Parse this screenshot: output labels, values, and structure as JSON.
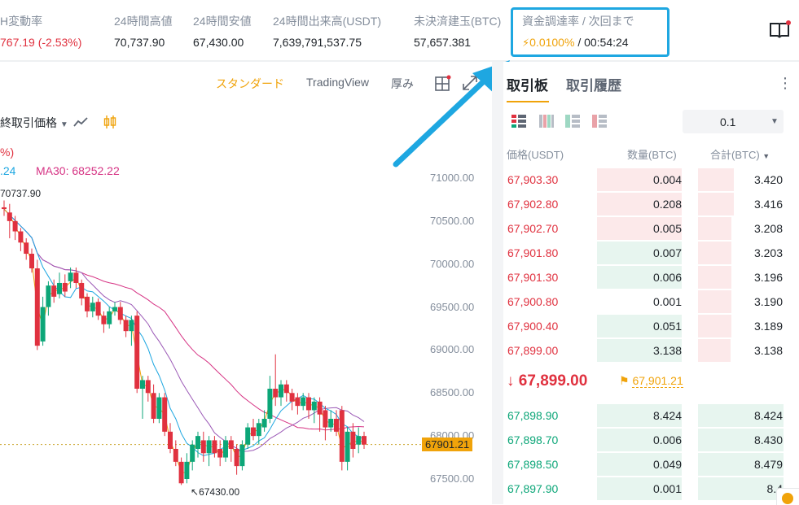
{
  "stats": [
    {
      "label": "H変動率",
      "value": "767.19 (-2.53%)",
      "color": "#e0313f"
    },
    {
      "label": "24時間高値",
      "value": "70,737.90"
    },
    {
      "label": "24時間安値",
      "value": "67,430.00"
    },
    {
      "label": "24時間出来高(USDT)",
      "value": "7,639,791,537.75"
    },
    {
      "label": "未決済建玉(BTC)",
      "value": "57,657.381"
    },
    {
      "label": "資金調達率 / 次回まで",
      "rate": "0.0100%",
      "countdown": "/ 00:54:24"
    }
  ],
  "chart_toolbar": {
    "standard": "スタンダード",
    "tradingview": "TradingView",
    "depth": "厚み"
  },
  "chart_header": {
    "price_type": "終取引価格",
    "pct_text": "%)",
    "ma_left": ".24",
    "ma30": "MA30: 68252.22",
    "high_label": "70737.90",
    "low_label": "67430.00",
    "current_price_tag": "67901.21"
  },
  "y_ticks": [
    "71000.00",
    "70500.00",
    "70000.00",
    "69500.00",
    "69000.00",
    "68500.00",
    "68000.00",
    "67500.00"
  ],
  "candles": [
    [
      70660,
      70640,
      70740,
      70560
    ],
    [
      70600,
      70500,
      70700,
      70300
    ],
    [
      70500,
      70380,
      70560,
      70280
    ],
    [
      70380,
      70250,
      70420,
      70150
    ],
    [
      70250,
      70120,
      70300,
      70050
    ],
    [
      70120,
      69950,
      70180,
      69900
    ],
    [
      69950,
      69050,
      70050,
      69000
    ],
    [
      69100,
      69500,
      69620,
      69050
    ],
    [
      69500,
      69750,
      69800,
      69400
    ],
    [
      69750,
      69620,
      69820,
      69550
    ],
    [
      69650,
      69780,
      69900,
      69600
    ],
    [
      69780,
      69680,
      69880,
      69620
    ],
    [
      69800,
      69900,
      69960,
      69720
    ],
    [
      69900,
      69780,
      69960,
      69720
    ],
    [
      69780,
      69600,
      69820,
      69520
    ],
    [
      69620,
      69450,
      69660,
      69380
    ],
    [
      69450,
      69550,
      69620,
      69380
    ],
    [
      69560,
      69400,
      69600,
      69350
    ],
    [
      69400,
      69300,
      69450,
      69200
    ],
    [
      69300,
      69450,
      69500,
      69250
    ],
    [
      69450,
      69500,
      69560,
      69400
    ],
    [
      69500,
      69350,
      69560,
      69300
    ],
    [
      69350,
      69220,
      69400,
      69150
    ],
    [
      69220,
      69350,
      69400,
      69050
    ],
    [
      69400,
      68550,
      69450,
      68500
    ],
    [
      68550,
      68650,
      68700,
      68200
    ],
    [
      68650,
      68500,
      68700,
      68400
    ],
    [
      68500,
      68200,
      68600,
      68150
    ],
    [
      68200,
      68450,
      68500,
      68150
    ],
    [
      68450,
      68050,
      68500,
      68000
    ],
    [
      68050,
      67850,
      68150,
      67800
    ],
    [
      67850,
      67700,
      67950,
      67650
    ],
    [
      67700,
      67450,
      67750,
      67430
    ],
    [
      67500,
      67700,
      67800,
      67450
    ],
    [
      67700,
      67900,
      67950,
      67600
    ],
    [
      67850,
      68000,
      68050,
      67750
    ],
    [
      67950,
      67800,
      68050,
      67700
    ],
    [
      67800,
      67950,
      68000,
      67650
    ],
    [
      67950,
      67800,
      68000,
      67750
    ],
    [
      67850,
      67750,
      67950,
      67650
    ],
    [
      67750,
      67950,
      68000,
      67700
    ],
    [
      67950,
      67850,
      68000,
      67700
    ],
    [
      67850,
      67650,
      67900,
      67550
    ],
    [
      67650,
      67900,
      67950,
      67600
    ],
    [
      67900,
      68100,
      68150,
      67850
    ],
    [
      68100,
      68000,
      68200,
      67950
    ],
    [
      68000,
      68150,
      68200,
      67900
    ],
    [
      68100,
      68200,
      68300,
      68050
    ],
    [
      68200,
      68550,
      68700,
      68150
    ],
    [
      68550,
      68450,
      68950,
      68350
    ],
    [
      68450,
      68600,
      68650,
      68350
    ],
    [
      68600,
      68500,
      68650,
      68400
    ],
    [
      68500,
      68400,
      68550,
      68300
    ],
    [
      68450,
      68350,
      68500,
      68250
    ],
    [
      68350,
      68450,
      68500,
      68300
    ],
    [
      68450,
      68300,
      68500,
      68200
    ],
    [
      68300,
      68400,
      68450,
      68150
    ],
    [
      68400,
      68250,
      68450,
      68050
    ],
    [
      68300,
      68100,
      68350,
      67950
    ],
    [
      68100,
      68200,
      68300,
      68050
    ],
    [
      68200,
      68050,
      68300,
      68000
    ],
    [
      68300,
      67700,
      68350,
      67600
    ],
    [
      67700,
      68050,
      68100,
      67600
    ],
    [
      68050,
      67850,
      68150,
      67750
    ],
    [
      67900,
      68000,
      68100,
      67800
    ],
    [
      68000,
      67900,
      68050,
      67850
    ]
  ],
  "orderbook": {
    "tabs": [
      "取引板",
      "取引履歴"
    ],
    "precision": "0.1",
    "headers": {
      "price": "価格(USDT)",
      "qty": "数量(BTC)",
      "total": "合計(BTC)"
    },
    "asks": [
      {
        "price": "67,903.30",
        "qty": "0.004",
        "total": "3.420",
        "q_share": 1.0,
        "t_share": 0.42
      },
      {
        "price": "67,902.80",
        "qty": "0.208",
        "total": "3.416",
        "q_share": 1.0,
        "t_share": 0.42
      },
      {
        "price": "67,902.70",
        "qty": "0.005",
        "total": "3.208",
        "q_share": 1.0,
        "t_share": 0.39
      },
      {
        "price": "67,901.80",
        "qty": "0.007",
        "total": "3.203",
        "q_share": 1.0,
        "t_share": 0.39,
        "q_green": true
      },
      {
        "price": "67,901.30",
        "qty": "0.006",
        "total": "3.196",
        "q_share": 1.0,
        "t_share": 0.39,
        "q_green": true
      },
      {
        "price": "67,900.80",
        "qty": "0.001",
        "total": "3.190",
        "q_share": 0.0,
        "t_share": 0.39
      },
      {
        "price": "67,900.40",
        "qty": "0.051",
        "total": "3.189",
        "q_share": 1.0,
        "t_share": 0.39,
        "q_green": true
      },
      {
        "price": "67,899.00",
        "qty": "3.138",
        "total": "3.138",
        "q_share": 1.0,
        "t_share": 0.38,
        "q_green": true
      }
    ],
    "last_price": "67,899.00",
    "mark_price": "67,901.21",
    "bids": [
      {
        "price": "67,898.90",
        "qty": "8.424",
        "total": "8.424",
        "q_share": 1.0,
        "t_share": 1.0
      },
      {
        "price": "67,898.70",
        "qty": "0.006",
        "total": "8.430",
        "q_share": 1.0,
        "t_share": 1.0
      },
      {
        "price": "67,898.50",
        "qty": "0.049",
        "total": "8.479",
        "q_share": 1.0,
        "t_share": 1.0
      },
      {
        "price": "67,897.90",
        "qty": "0.001",
        "total": "8.4",
        "q_share": 1.0,
        "t_share": 1.0
      }
    ]
  },
  "colors": {
    "red": "#e0313f",
    "green": "#0ca678",
    "orange": "#f0a30a",
    "highlight": "#1ea7e1"
  }
}
